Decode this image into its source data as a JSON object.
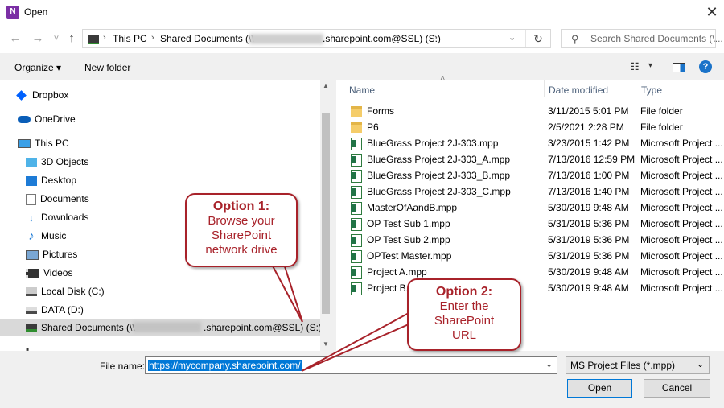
{
  "window": {
    "title": "Open",
    "close_glyph": "✕",
    "app_icon": "onenote-icon"
  },
  "nav": {
    "back_glyph": "←",
    "forward_glyph": "→",
    "recent_glyph": "˅",
    "up_glyph": "↑",
    "breadcrumb": [
      "This PC",
      "Shared Documents (\\\\",
      ".sharepoint.com@SSL) (S:)"
    ],
    "sep_glyph": "›",
    "dropdown_glyph": "⌄",
    "refresh_glyph": "↻",
    "search_placeholder": "Search Shared Documents (\\...",
    "search_glyph": "⚲"
  },
  "toolbar": {
    "organize_label": "Organize ▾",
    "new_folder_label": "New folder",
    "view_glyph": "☷",
    "view_dd_glyph": "▾",
    "help_glyph": "?"
  },
  "sidebar": {
    "items": [
      {
        "label": "Dropbox",
        "icon": "dropbox-icon"
      },
      {
        "label": "OneDrive",
        "icon": "onedrive-icon"
      },
      {
        "label": "This PC",
        "icon": "computer-icon"
      },
      {
        "label": "3D Objects",
        "icon": "cube-icon"
      },
      {
        "label": "Desktop",
        "icon": "desktop-icon"
      },
      {
        "label": "Documents",
        "icon": "document-icon"
      },
      {
        "label": "Downloads",
        "icon": "download-icon"
      },
      {
        "label": "Music",
        "icon": "music-icon"
      },
      {
        "label": "Pictures",
        "icon": "pictures-icon"
      },
      {
        "label": "Videos",
        "icon": "video-icon"
      },
      {
        "label": "Local Disk (C:)",
        "icon": "disk-icon"
      },
      {
        "label": "DATA (D:)",
        "icon": "drive-icon"
      },
      {
        "label_start": "Shared Documents (\\\\",
        "label_end": ".sharepoint.com@SSL) (S:)",
        "icon": "network-drive-icon"
      }
    ]
  },
  "columns": {
    "name": "Name",
    "date": "Date modified",
    "type": "Type",
    "sort_glyph": "˄"
  },
  "files": [
    {
      "name": "Forms",
      "date": "3/11/2015 5:01 PM",
      "type": "File folder",
      "kind": "folder"
    },
    {
      "name": "P6",
      "date": "2/5/2021 2:28 PM",
      "type": "File folder",
      "kind": "folder"
    },
    {
      "name": "BlueGrass Project 2J-303.mpp",
      "date": "3/23/2015 1:42 PM",
      "type": "Microsoft Project ...",
      "kind": "project"
    },
    {
      "name": "BlueGrass Project 2J-303_A.mpp",
      "date": "7/13/2016 12:59 PM",
      "type": "Microsoft Project ...",
      "kind": "project"
    },
    {
      "name": "BlueGrass Project 2J-303_B.mpp",
      "date": "7/13/2016 1:00 PM",
      "type": "Microsoft Project ...",
      "kind": "project"
    },
    {
      "name": "BlueGrass Project 2J-303_C.mpp",
      "date": "7/13/2016 1:40 PM",
      "type": "Microsoft Project ...",
      "kind": "project"
    },
    {
      "name": "MasterOfAandB.mpp",
      "date": "5/30/2019 9:48 AM",
      "type": "Microsoft Project ...",
      "kind": "project"
    },
    {
      "name": "OP Test Sub 1.mpp",
      "date": "5/31/2019 5:36 PM",
      "type": "Microsoft Project ...",
      "kind": "project"
    },
    {
      "name": "OP Test Sub 2.mpp",
      "date": "5/31/2019 5:36 PM",
      "type": "Microsoft Project ...",
      "kind": "project"
    },
    {
      "name": "OPTest Master.mpp",
      "date": "5/31/2019 5:36 PM",
      "type": "Microsoft Project ...",
      "kind": "project"
    },
    {
      "name": "Project A.mpp",
      "date": "5/30/2019 9:48 AM",
      "type": "Microsoft Project ...",
      "kind": "project"
    },
    {
      "name": "Project B.mpp",
      "date": "5/30/2019 9:48 AM",
      "type": "Microsoft Project ...",
      "kind": "project"
    }
  ],
  "footer": {
    "filename_label": "File name:",
    "filename_value": "https://mycompany.sharepoint.com/",
    "dropdown_glyph": "⌄",
    "filetype_value": "MS Project Files (*.mpp)",
    "open_label": "Open",
    "cancel_label": "Cancel"
  },
  "callouts": {
    "option1_title": "Option 1:",
    "option1_lines": [
      "Browse your",
      "SharePoint",
      "network drive"
    ],
    "option2_title": "Option 2:",
    "option2_lines": [
      "Enter the",
      "SharePoint",
      "URL"
    ]
  },
  "colors": {
    "accent": "#0078d7",
    "callout": "#a8222a",
    "selection": "#0078d7"
  }
}
